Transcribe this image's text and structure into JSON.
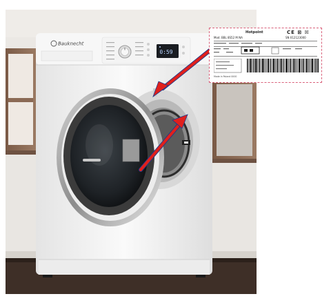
{
  "brand_logo_text": "Bauknecht",
  "display_readout": "0:59",
  "rating_label": {
    "brand": "Hotpoint",
    "model_line": "Mod. BBL 8S52 M NA",
    "code_line": "SN 012123000",
    "cert_marks": "CE ⊠ ☒",
    "footer_line": "Made in Poland 0000"
  },
  "colors": {
    "wall": "#e9e6e2",
    "wall_shadow": "#d6d2cc",
    "cabinet_wood": "#8b6a55",
    "floor": "#3e2f27",
    "machine_body": "#f3f3f3",
    "door_ring": "#4a4a4a",
    "glass": "#1f2326",
    "arrow": "#e0201c",
    "arrow_outline": "#1b3a8c",
    "label_border": "#d9607a"
  },
  "annotations": {
    "arrow_count": 2,
    "arrow_targets": [
      "door-frame-label",
      "inner-door-label"
    ]
  }
}
